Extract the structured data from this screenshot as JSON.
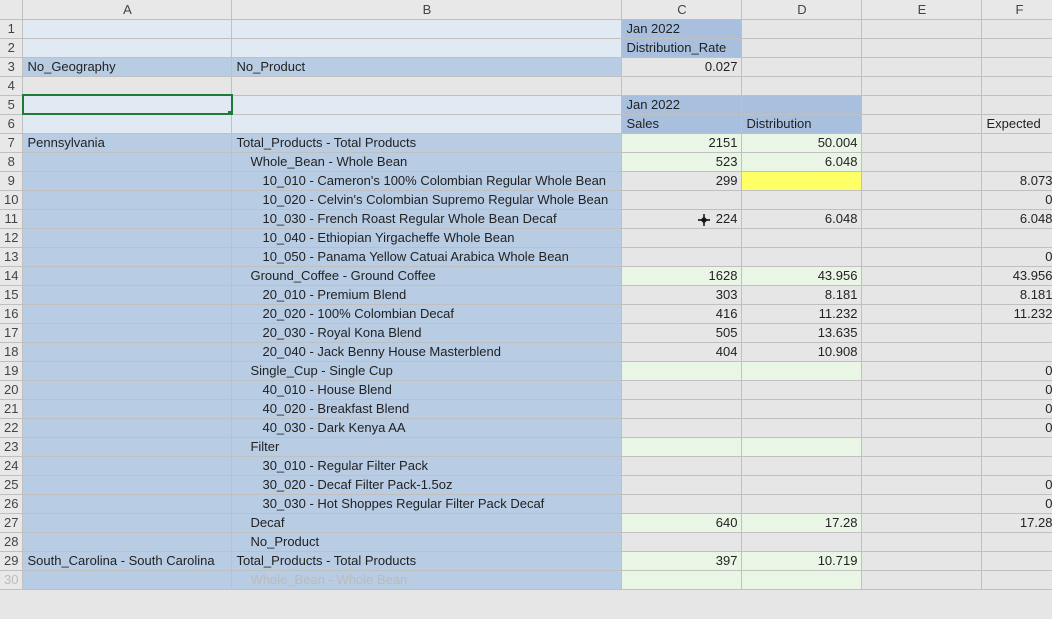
{
  "columns": [
    "A",
    "B",
    "C",
    "D",
    "E",
    "F"
  ],
  "row_headers": [
    1,
    2,
    3,
    4,
    5,
    6,
    7,
    8,
    9,
    10,
    11,
    12,
    13,
    14,
    15,
    16,
    17,
    18,
    19,
    20,
    21,
    22,
    23,
    24,
    25,
    26,
    27,
    28,
    29,
    30
  ],
  "r1": {
    "c": "Jan 2022"
  },
  "r2": {
    "c": "Distribution_Rate"
  },
  "r3": {
    "a": "No_Geography",
    "b": "No_Product",
    "c": "0.027"
  },
  "r5": {
    "c": "Jan 2022"
  },
  "r6": {
    "c": "Sales",
    "d": "Distribution",
    "f": "Expected"
  },
  "r7": {
    "a": "Pennsylvania",
    "b": "Total_Products - Total Products",
    "c": "2151",
    "d": "50.004"
  },
  "r8": {
    "b": "Whole_Bean - Whole Bean",
    "c": "523",
    "d": "6.048"
  },
  "r9": {
    "b": "10_010 - Cameron's 100% Colombian Regular Whole Bean",
    "c": "299",
    "f": "8.073"
  },
  "r10": {
    "b": "10_020 - Celvin's Colombian Supremo Regular Whole Bean",
    "f": "0"
  },
  "r11": {
    "b": "10_030 - French Roast Regular Whole Bean Decaf",
    "c": "224",
    "d": "6.048",
    "f": "6.048"
  },
  "r12": {
    "b": "10_040 - Ethiopian Yirgacheffe Whole Bean"
  },
  "r13": {
    "b": "10_050 - Panama Yellow Catuai Arabica Whole Bean",
    "f": "0"
  },
  "r14": {
    "b": "Ground_Coffee - Ground Coffee",
    "c": "1628",
    "d": "43.956",
    "f": "43.956"
  },
  "r15": {
    "b": "20_010 - Premium Blend",
    "c": "303",
    "d": "8.181",
    "f": "8.181"
  },
  "r16": {
    "b": "20_020 - 100% Colombian Decaf",
    "c": "416",
    "d": "11.232",
    "f": "11.232"
  },
  "r17": {
    "b": "20_030 - Royal Kona Blend",
    "c": "505",
    "d": "13.635"
  },
  "r18": {
    "b": "20_040 - Jack Benny House Masterblend",
    "c": "404",
    "d": "10.908"
  },
  "r19": {
    "b": "Single_Cup - Single Cup",
    "f": "0"
  },
  "r20": {
    "b": "40_010 - House Blend",
    "f": "0"
  },
  "r21": {
    "b": "40_020 - Breakfast Blend",
    "f": "0"
  },
  "r22": {
    "b": "40_030 - Dark Kenya AA",
    "f": "0"
  },
  "r23": {
    "b": "Filter"
  },
  "r24": {
    "b": "30_010 - Regular Filter Pack"
  },
  "r25": {
    "b": "30_020 - Decaf Filter Pack-1.5oz",
    "f": "0"
  },
  "r26": {
    "b": "30_030 - Hot Shoppes Regular Filter Pack Decaf",
    "f": "0"
  },
  "r27": {
    "b": "Decaf",
    "c": "640",
    "d": "17.28",
    "f": "17.28"
  },
  "r28": {
    "b": "No_Product"
  },
  "r29": {
    "a": "South_Carolina - South Carolina",
    "b": "Total_Products - Total Products",
    "c": "397",
    "d": "10.719"
  },
  "r30": {
    "b": "Whole_Bean - Whole Bean"
  }
}
